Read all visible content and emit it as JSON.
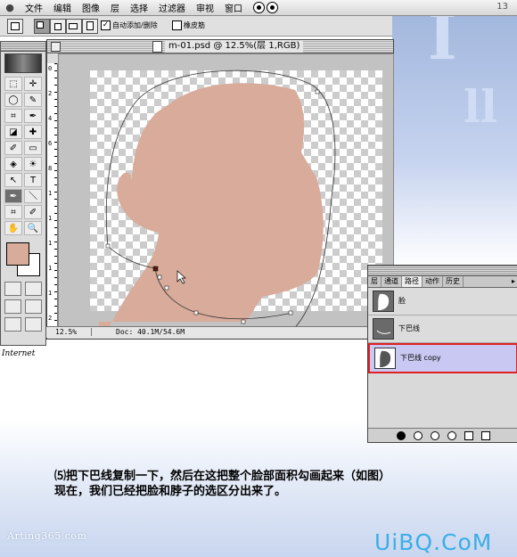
{
  "menubar": {
    "apple": "",
    "items": [
      "文件",
      "编辑",
      "图像",
      "层",
      "选择",
      "过滤器",
      "审视",
      "窗口"
    ],
    "page_number": "13"
  },
  "options_bar": {
    "auto_add_delete_label": "自动添加/删除",
    "auto_add_delete_checked": true,
    "rubber_band_label": "橡皮筋",
    "rubber_band_checked": false
  },
  "toolbox": {
    "tools": [
      "⬚",
      "✛",
      "◯",
      "✎",
      "⌗",
      "✒",
      "◪",
      "✚",
      "✐",
      "▭",
      "◈",
      "☀",
      "↖",
      "T",
      "✒",
      "＼",
      "⌗",
      "✐",
      "✋",
      "🔍"
    ],
    "foreground_color": "#d8ab9a",
    "background_color": "#ffffff",
    "internet_label": "Internet"
  },
  "document": {
    "title": "m-01.psd @ 12.5%(层 1,RGB)",
    "ruler_top": [
      "0",
      "2",
      "4",
      "6",
      "8",
      "10",
      "12",
      "14",
      "16",
      "18"
    ],
    "ruler_left": [
      "0",
      "2",
      "4",
      "6",
      "8",
      "1",
      "1",
      "1",
      "1",
      "1",
      "2"
    ],
    "zoom": "12.5%",
    "doc_size": "Doc: 40.1M/54.6M",
    "skin_color": "#d8ab9a"
  },
  "paths_palette": {
    "tabs": [
      "层",
      "通道",
      "路径",
      "动作",
      "历史"
    ],
    "active_tab": "路径",
    "items": [
      {
        "label": "脸",
        "selected": false
      },
      {
        "label": "下巴线",
        "selected": false
      },
      {
        "label": "下巴线 copy",
        "selected": true
      }
    ]
  },
  "caption": {
    "line1": "⑸把下巴线复制一下，然后在这把整个脸部面积勾画起来（如图）",
    "line2": "现在，我们已经把脸和脖子的选区分出来了。"
  },
  "watermarks": {
    "left": "Arting365.com",
    "right": "UiBQ.CoM"
  }
}
